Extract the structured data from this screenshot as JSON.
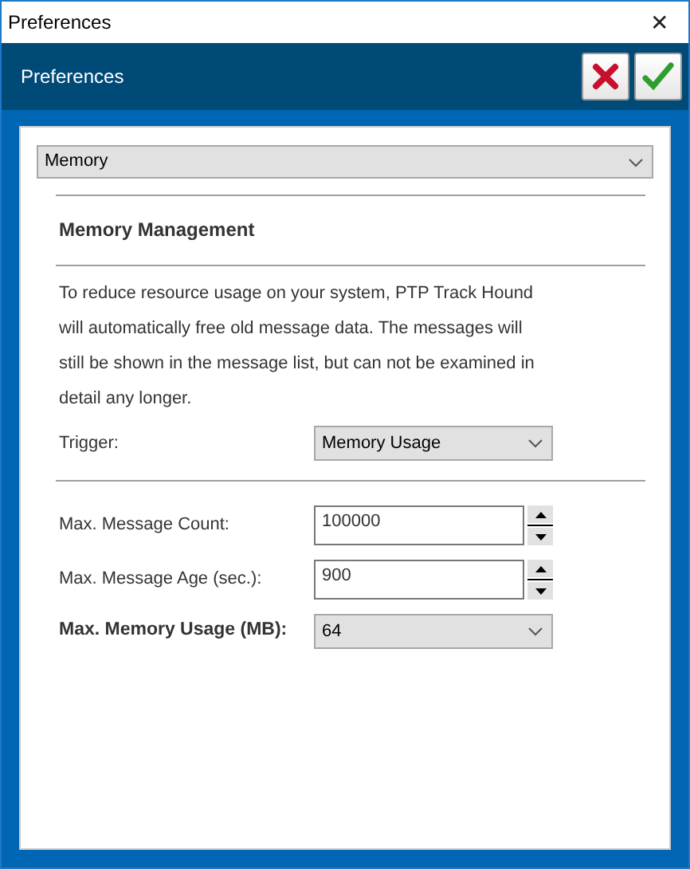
{
  "window": {
    "title": "Preferences",
    "close": "✕"
  },
  "header": {
    "title": "Preferences",
    "buttons": [
      {
        "kind": "cancel"
      },
      {
        "kind": "ok"
      }
    ]
  },
  "category": {
    "value": "Memory"
  },
  "section": {
    "title": "Memory Management",
    "description": "To reduce resource usage on your system, PTP Track Hound will automatically free old message data. The messages will still be shown in the message list, but can not be examined in detail any longer."
  },
  "trigger": {
    "label": "Trigger:",
    "value": "Memory Usage"
  },
  "fields": [
    {
      "kind": "spin",
      "label": "Max. Message Count:",
      "value": "100000",
      "bold": false
    },
    {
      "kind": "spin",
      "label": "Max. Message Age (sec.):",
      "value": "900",
      "bold": false
    },
    {
      "kind": "select",
      "label": "Max. Memory Usage (MB):",
      "value": "64",
      "bold": true
    }
  ]
}
